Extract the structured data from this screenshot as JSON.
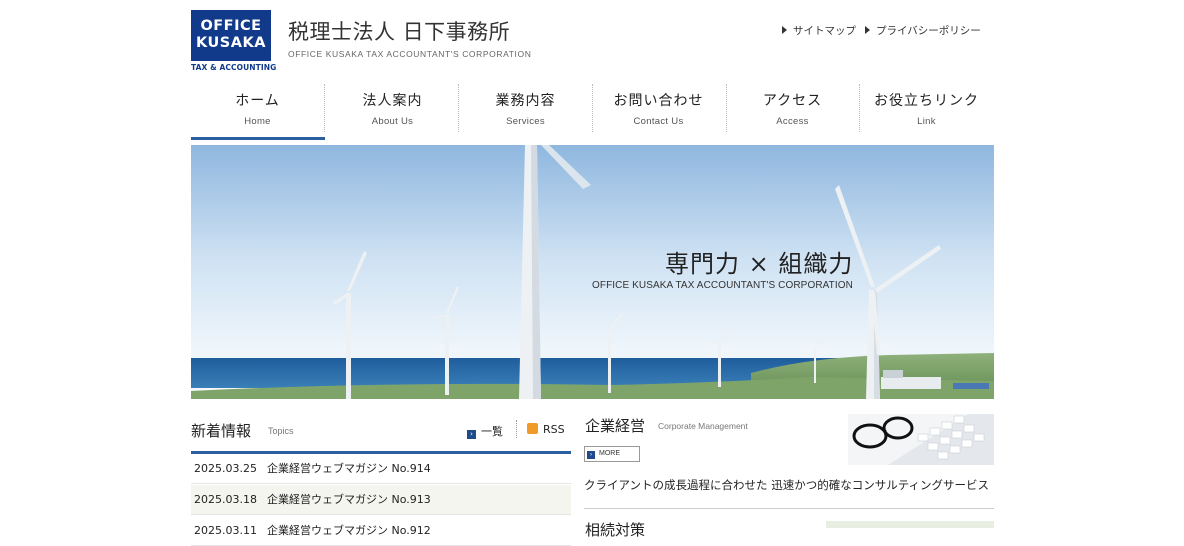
{
  "header": {
    "logo": {
      "line1": "OFFICE",
      "line2": "KUSAKA",
      "sub": "TAX & ACCOUNTING",
      "color": "#123a8a"
    },
    "title": "税理士法人 日下事務所",
    "subtitle": "OFFICE KUSAKA TAX  ACCOUNTANT'S CORPORATION",
    "utility_links": [
      {
        "label": "サイトマップ",
        "icon": "triangle-right-icon"
      },
      {
        "label": "プライバシーポリシー",
        "icon": "triangle-right-icon"
      }
    ]
  },
  "nav": {
    "accent": "#2b5fa0",
    "items": [
      {
        "label": "ホーム",
        "en": "Home",
        "active": true
      },
      {
        "label": "法人案内",
        "en": "About Us"
      },
      {
        "label": "業務内容",
        "en": "Services"
      },
      {
        "label": "お問い合わせ",
        "en": "Contact Us"
      },
      {
        "label": "アクセス",
        "en": "Access"
      },
      {
        "label": "お役立ちリンク",
        "en": "Link"
      }
    ]
  },
  "hero": {
    "title": "専門力 × 組織力",
    "subtitle": "OFFICE KUSAKA TAX ACCOUNTANT'S CORPORATION"
  },
  "topics": {
    "title": "新着情報",
    "title_en": "Topics",
    "list_link": "一覧",
    "rss_link": "RSS",
    "items": [
      {
        "date": "2025.03.25",
        "text": "企業経営ウェブマガジン No.914"
      },
      {
        "date": "2025.03.18",
        "text": "企業経営ウェブマガジン No.913"
      },
      {
        "date": "2025.03.11",
        "text": "企業経営ウェブマガジン No.912"
      }
    ]
  },
  "corporate": {
    "title": "企業経営",
    "title_en": "Corporate Management",
    "more_label": "MORE",
    "description": "クライアントの成長過程に合わせた 迅速かつ的確なコンサルティングサービス"
  },
  "next_section": {
    "title": "相続対策"
  }
}
